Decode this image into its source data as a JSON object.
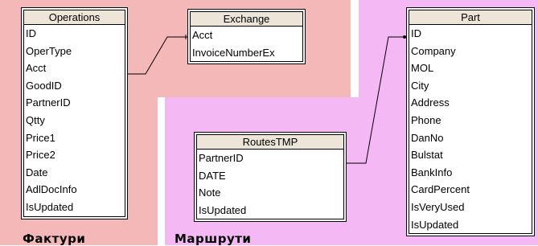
{
  "regions": {
    "left_label": "Фактури",
    "right_label": "Маршрути"
  },
  "tables": {
    "operations": {
      "title": "Operations",
      "fields": [
        "ID",
        "OperType",
        "Acct",
        "GoodID",
        "PartnerID",
        "Qtty",
        "Price1",
        "Price2",
        "Date",
        "AdlDocInfo",
        "IsUpdated"
      ]
    },
    "exchange": {
      "title": "Exchange",
      "fields": [
        "Acct",
        "InvoiceNumberEx"
      ]
    },
    "routestmp": {
      "title": "RoutesTMP",
      "fields": [
        "PartnerID",
        "DATE",
        "Note",
        "IsUpdated"
      ]
    },
    "part": {
      "title": "Part",
      "fields": [
        "ID",
        "Company",
        "MOL",
        "City",
        "Address",
        "Phone",
        "DanNo",
        "Bulstat",
        "BankInfo",
        "CardPercent",
        "IsVeryUsed",
        "IsUpdated"
      ]
    }
  },
  "colors": {
    "left_region": "#f4b8b8",
    "right_region": "#f4b8f4",
    "header": "#ede6d8"
  }
}
